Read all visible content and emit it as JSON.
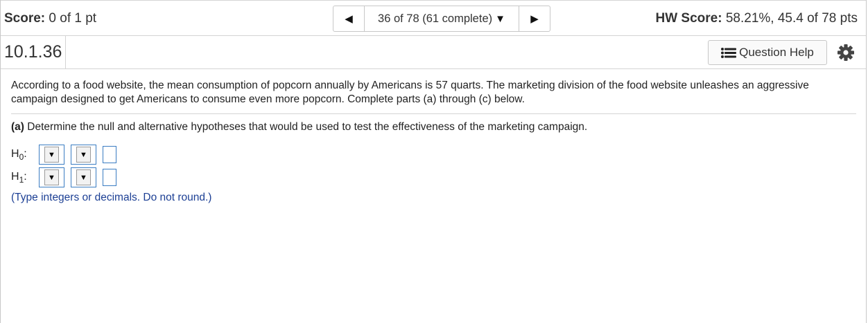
{
  "topbar": {
    "score_label": "Score:",
    "score_value": "0 of 1 pt",
    "nav_prev_icon": "triangle-left",
    "nav_position": "36 of 78 (61 complete)",
    "nav_caret_icon": "triangle-down",
    "nav_next_icon": "triangle-right",
    "hw_label": "HW Score:",
    "hw_value": "58.21%, 45.4 of 78 pts"
  },
  "question": {
    "number": "10.1.36",
    "help_label": "Question Help",
    "help_icon": "list-icon",
    "settings_icon": "gear-icon"
  },
  "content": {
    "intro": "According to a food website, the mean consumption of popcorn annually by Americans is 57 quarts. The marketing division of the food website unleashes an aggressive campaign designed to get Americans to consume even more popcorn. Complete parts (a) through (c) below.",
    "part_a_label": "(a)",
    "part_a_text": "Determine the null and alternative hypotheses that would be used to test the effectiveness of the marketing campaign.",
    "hypotheses": [
      {
        "symbol": "H",
        "subscript": "0",
        "suffix": ":",
        "select1": "",
        "select2": "",
        "value": ""
      },
      {
        "symbol": "H",
        "subscript": "1",
        "suffix": ":",
        "select1": "",
        "select2": "",
        "value": ""
      }
    ],
    "hint": "(Type integers or decimals. Do not round.)"
  },
  "colors": {
    "input_border": "#3a7cc2",
    "hint_text": "#1c3f94"
  }
}
